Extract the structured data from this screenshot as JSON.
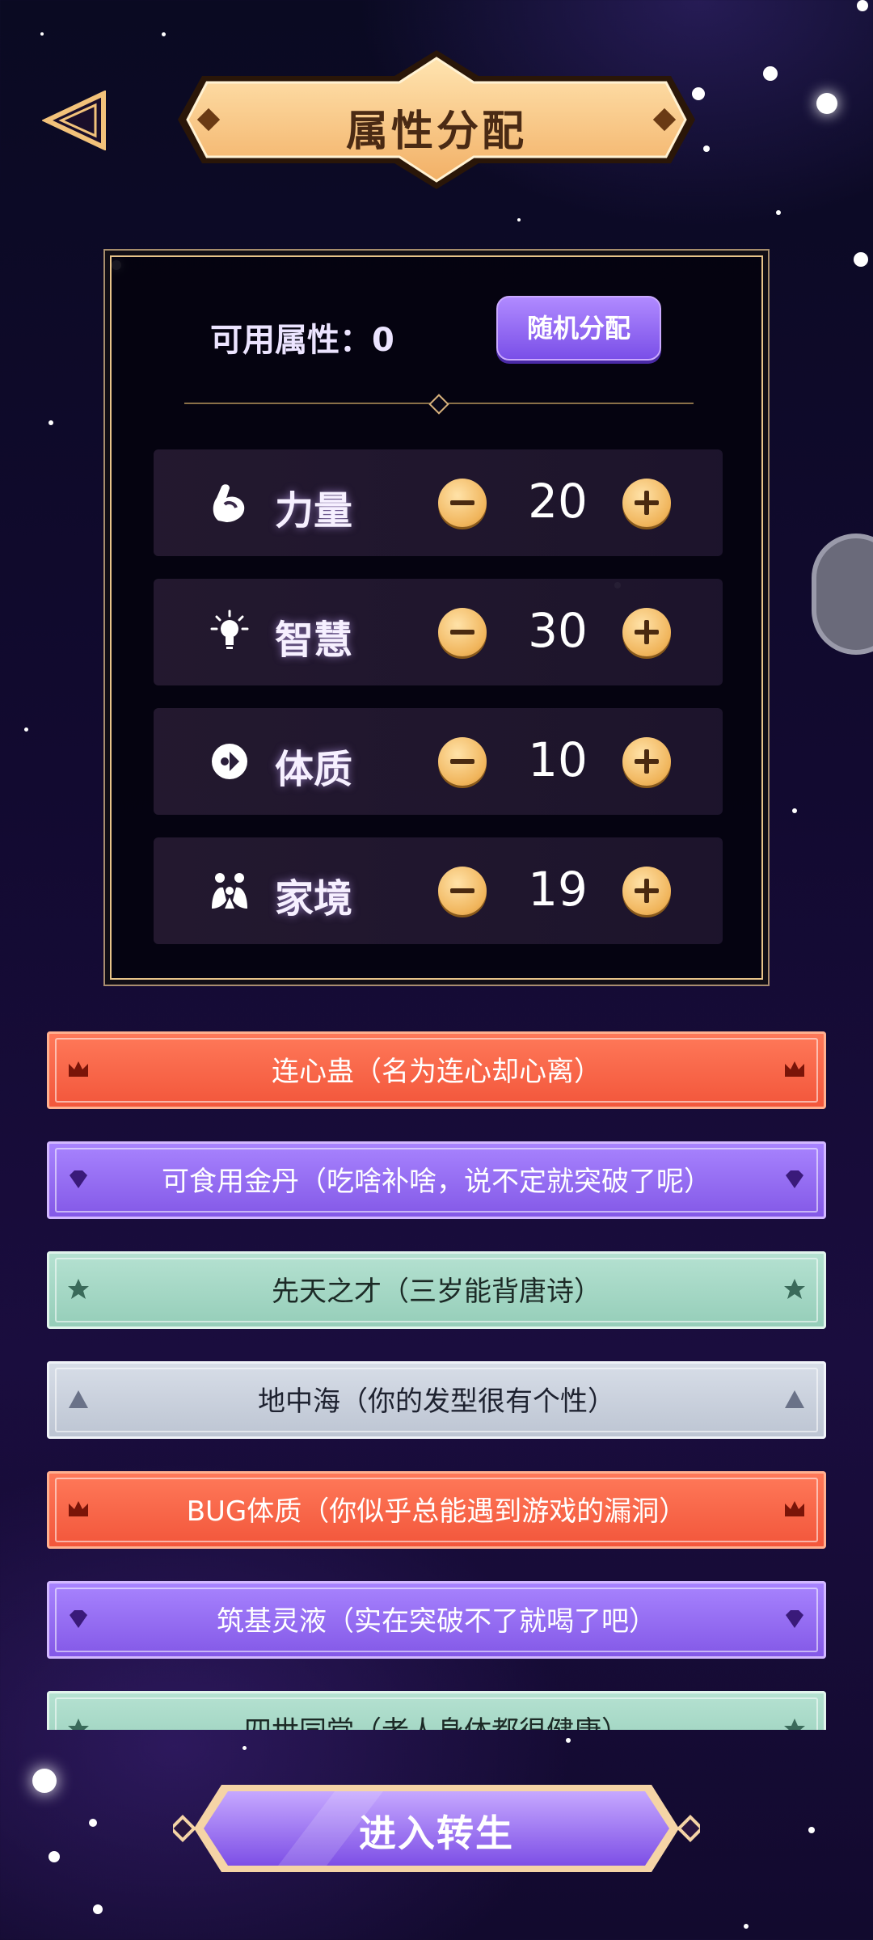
{
  "header": {
    "title": "属性分配",
    "back_icon": "back-triangle-icon"
  },
  "panel": {
    "available_label": "可用属性：0",
    "random_button": "随机分配",
    "attributes": [
      {
        "label": "力量",
        "value": "20",
        "icon": "muscle-icon"
      },
      {
        "label": "智慧",
        "value": "30",
        "icon": "lightbulb-icon"
      },
      {
        "label": "体质",
        "value": "10",
        "icon": "body-icon"
      },
      {
        "label": "家境",
        "value": "19",
        "icon": "family-icon"
      }
    ]
  },
  "talents": [
    {
      "text": "连心蛊（名为连心却心离）",
      "color": "red",
      "icon": "crown-icon"
    },
    {
      "text": "可食用金丹（吃啥补啥，说不定就突破了呢）",
      "color": "purple",
      "icon": "gem-icon"
    },
    {
      "text": "先天之才（三岁能背唐诗）",
      "color": "green",
      "icon": "star-icon"
    },
    {
      "text": "地中海（你的发型很有个性）",
      "color": "gray",
      "icon": "triangle-icon"
    },
    {
      "text": "BUG体质（你似乎总能遇到游戏的漏洞）",
      "color": "red",
      "icon": "crown-icon"
    },
    {
      "text": "筑基灵液（实在突破不了就喝了吧）",
      "color": "purple",
      "icon": "gem-icon"
    },
    {
      "text": "四世同堂（老人身体都很健康）",
      "color": "green",
      "icon": "star-icon"
    }
  ],
  "footer": {
    "enter_button": "进入转生"
  },
  "colors": {
    "gold": "#f0b45a",
    "purple_button": "#8257e6",
    "red_talent": "#f2553a",
    "green_talent": "#94cdb8",
    "gray_talent": "#bcc4d2"
  }
}
